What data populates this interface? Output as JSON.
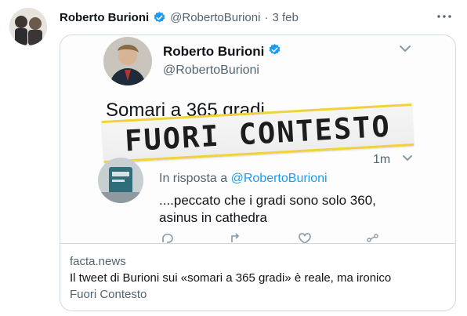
{
  "tweet": {
    "author_name": "Roberto Burioni",
    "handle": "@RobertoBurioni",
    "separator": "·",
    "date": "3 feb"
  },
  "card": {
    "domain": "facta.news",
    "title": "Il tweet di Burioni sui «somari a 365 gradi» è reale, ma ironico",
    "description": "Fuori Contesto",
    "image": {
      "author_name": "Roberto Burioni",
      "handle": "@RobertoBurioni",
      "tweet_text": "Somari a 365 gradi",
      "stamp_text": "FUORI CONTESTO",
      "time": "1m",
      "reply_prefix": "In risposta a ",
      "reply_to": "@RobertoBurioni",
      "reply_line1": "....peccato che i gradi sono solo 360,",
      "reply_line2": "asinus in cathedra"
    }
  },
  "icons": {
    "verified": "verified-badge-icon",
    "more": "more-icon",
    "chevron": "chevron-down-icon"
  },
  "colors": {
    "verified": "#1d9bf0",
    "secondary_text": "#536471",
    "border": "#cfd9de",
    "stamp_border": "#f2d23a"
  }
}
